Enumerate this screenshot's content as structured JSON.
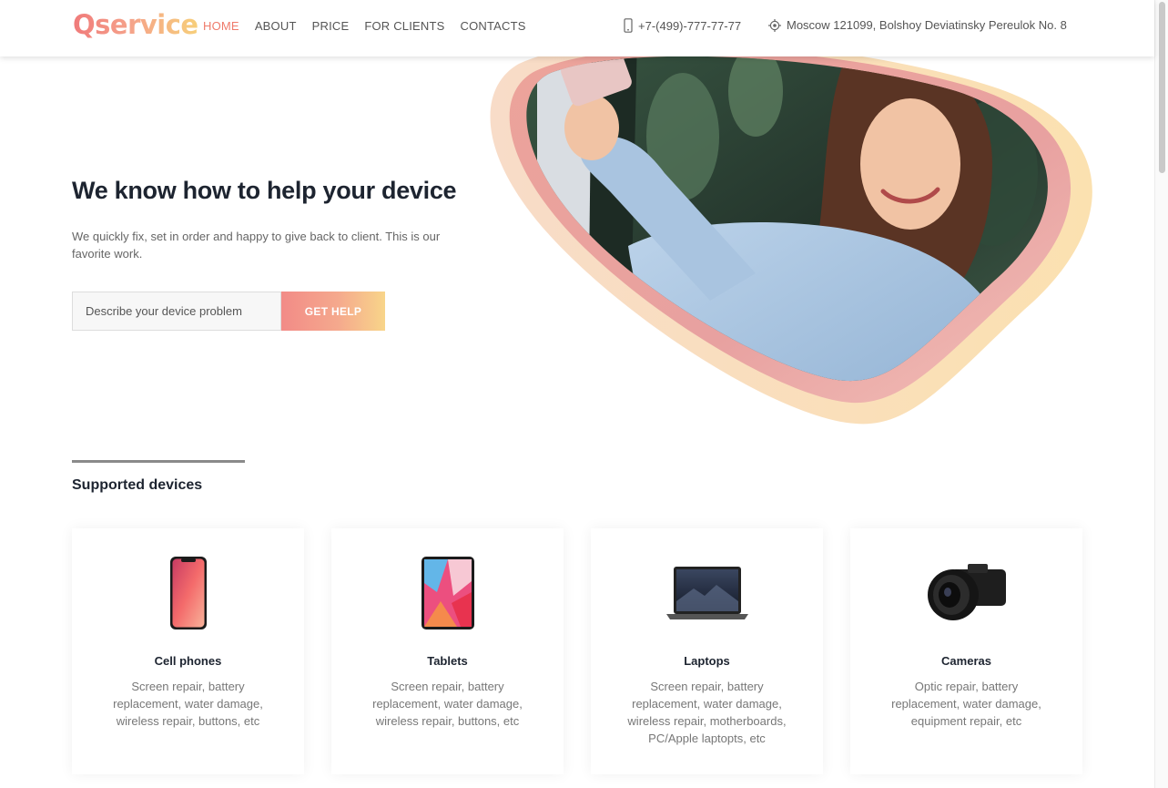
{
  "header": {
    "logo": "Qservice",
    "nav": [
      "HOME",
      "ABOUT",
      "PRICE",
      "FOR CLIENTS",
      "CONTACTS"
    ],
    "phone": "+7-(499)-777-77-77",
    "address": "Moscow 121099, Bolshoy Deviatinsky Pereulok No. 8",
    "icons": {
      "phone": "phone-icon",
      "address": "location-icon"
    }
  },
  "hero": {
    "title": "We know how to help your device",
    "description": "We quickly fix, set in order and happy to give back to client. This is our favorite work.",
    "input_placeholder": "Describe your device problem",
    "button_label": "GET HELP"
  },
  "devices": {
    "title": "Supported devices",
    "items": [
      {
        "name": "Cell phones",
        "desc": "Screen repair, battery replacement, water damage, wireless repair, buttons, etc"
      },
      {
        "name": "Tablets",
        "desc": "Screen repair, battery replacement, water damage, wireless repair, buttons, etc"
      },
      {
        "name": "Laptops",
        "desc": "Screen repair, battery replacement, water damage, wireless repair, motherboards, PC/Apple laptopts, etc"
      },
      {
        "name": "Cameras",
        "desc": "Optic repair, battery replacement, water damage, equipment repair, etc"
      }
    ]
  },
  "colors": {
    "accent": "#ef7b6b",
    "gradient_start": "#f28b87",
    "gradient_end": "#f8d58a",
    "heading": "#1d2430"
  }
}
